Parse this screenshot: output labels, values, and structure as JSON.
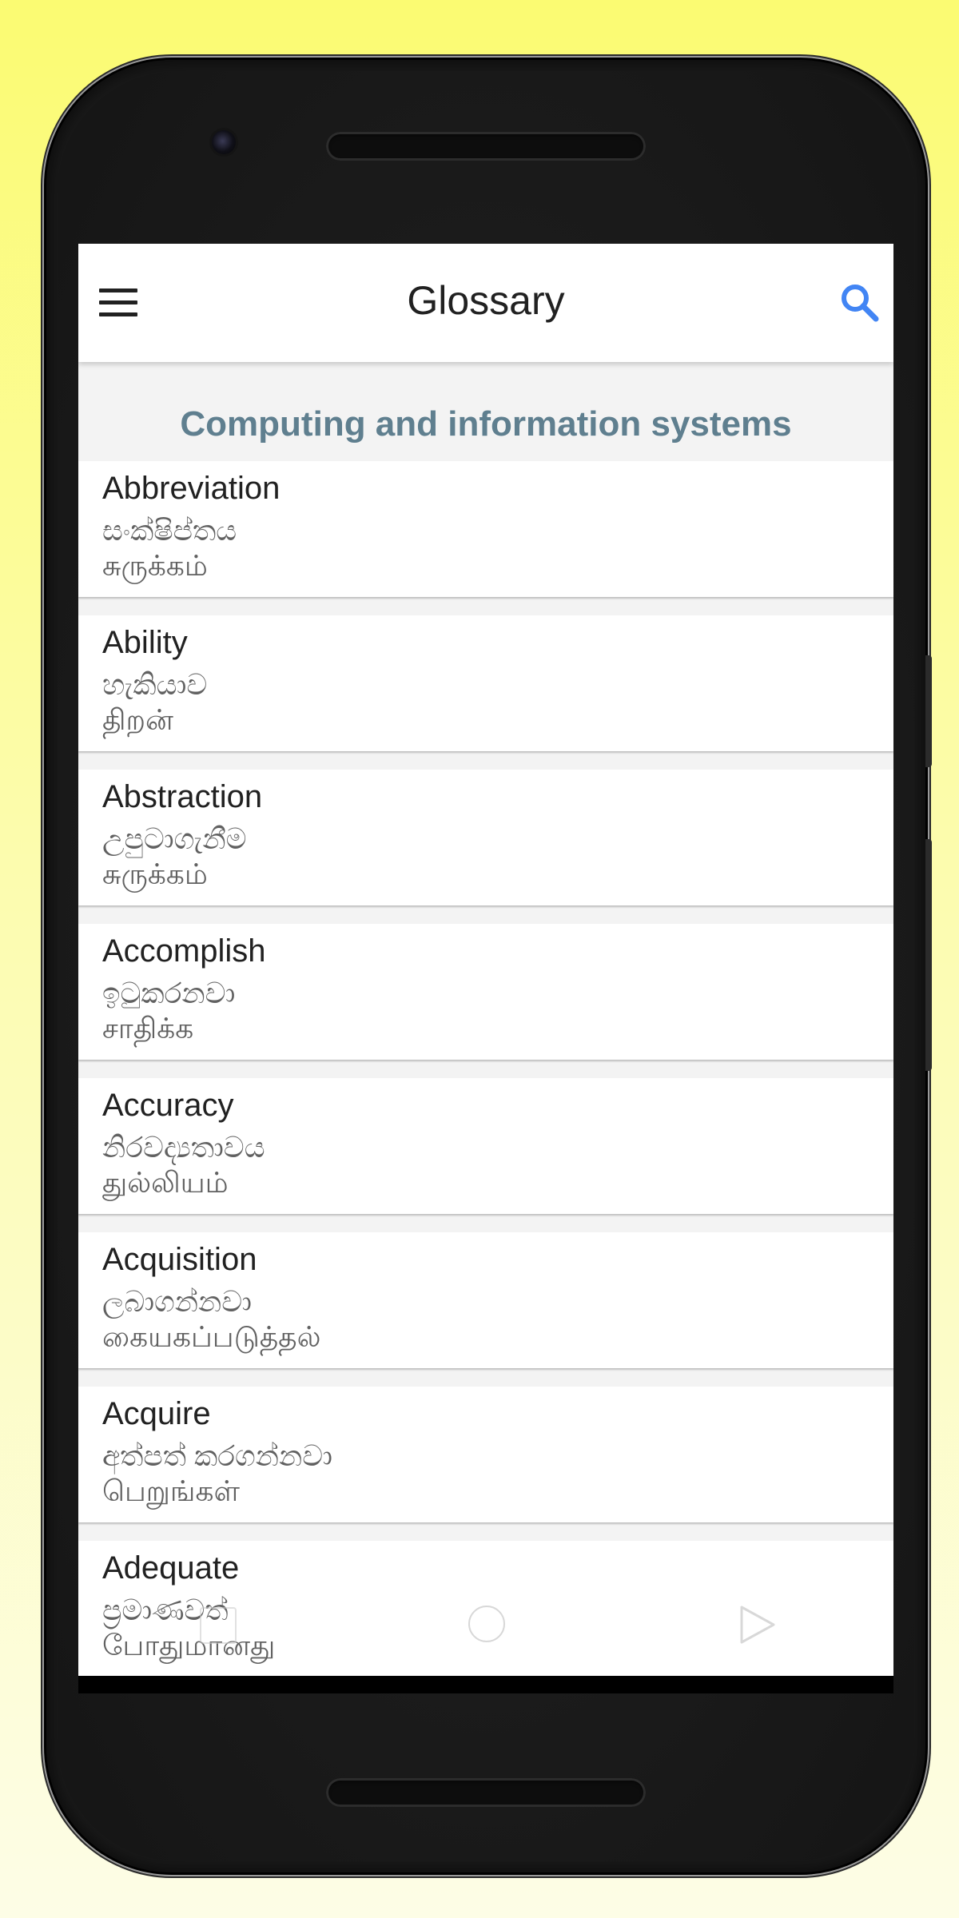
{
  "appbar": {
    "title": "Glossary",
    "menu_icon": "hamburger-menu-icon",
    "search_icon": "search-icon"
  },
  "section": {
    "title": "Computing and information systems"
  },
  "terms": [
    {
      "english": "Abbreviation",
      "sinhala": "සංක්ෂිප්තය",
      "tamil": "சுருக்கம்"
    },
    {
      "english": "Ability",
      "sinhala": "හැකියාව",
      "tamil": "திறன்"
    },
    {
      "english": "Abstraction",
      "sinhala": "උපුටාගැනීම",
      "tamil": "சுருக்கம்"
    },
    {
      "english": "Accomplish",
      "sinhala": "ඉටුකරනවා",
      "tamil": "சாதிக்க"
    },
    {
      "english": "Accuracy",
      "sinhala": "නිරවද්‍යතාවය",
      "tamil": "துல்லியம்"
    },
    {
      "english": "Acquisition",
      "sinhala": "ලබාගන්නවා",
      "tamil": "கையகப்படுத்தல்"
    },
    {
      "english": "Acquire",
      "sinhala": "අත්පත් කරගන්නවා",
      "tamil": "பெறுங்கள்"
    },
    {
      "english": "Adequate",
      "sinhala": "ප්‍රමාණවත්",
      "tamil": "போதுமானது"
    }
  ],
  "navbar": {
    "back_icon": "back-square-icon",
    "home_icon": "home-circle-icon",
    "recent_icon": "triangle-play-icon"
  },
  "colors": {
    "background_top": "#fbfb72",
    "accent": "#4285f4",
    "section_title": "#5f7f8f",
    "phone_body": "#1b1b1b"
  }
}
